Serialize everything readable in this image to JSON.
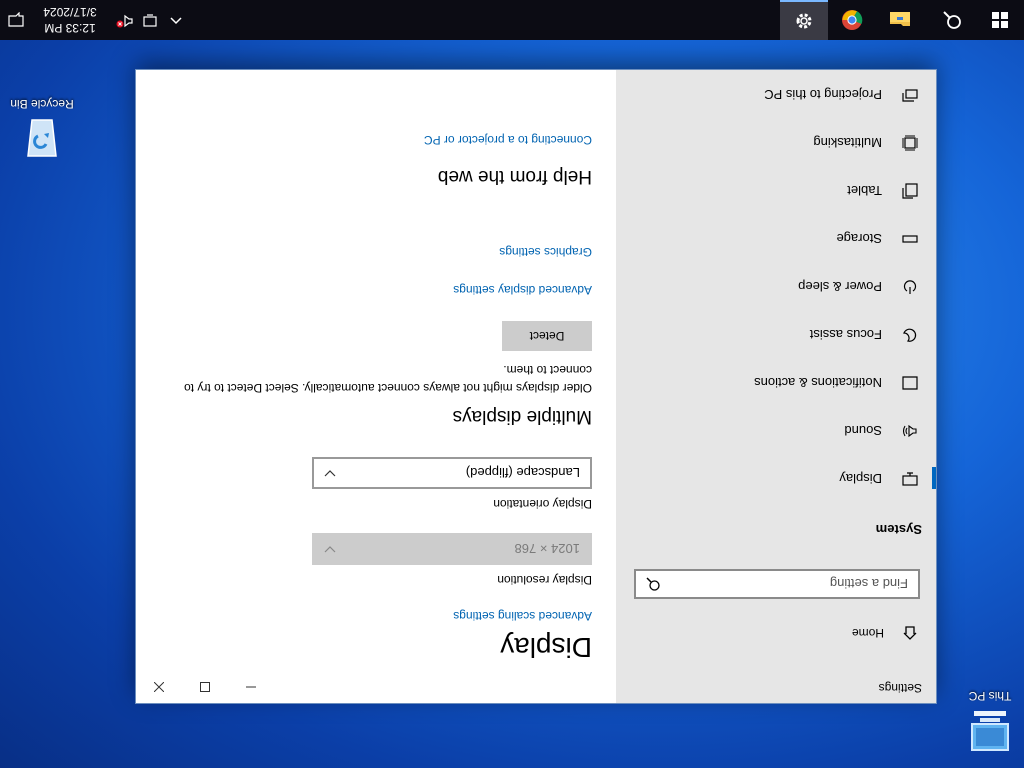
{
  "desktop": {
    "icons": [
      {
        "label": "This PC",
        "icon": "computer-icon"
      },
      {
        "label": "Recycle Bin",
        "icon": "recycle-bin-icon"
      }
    ]
  },
  "taskbar": {
    "clock_time": "12:33 PM",
    "clock_date": "3/17/2024",
    "apps": [
      "start",
      "search",
      "file-explorer",
      "chrome",
      "settings"
    ]
  },
  "window": {
    "app_title": "Settings",
    "home_label": "Home",
    "search_placeholder": "Find a setting",
    "section_label": "System",
    "nav": [
      {
        "label": "Display",
        "icon": "monitor-icon",
        "active": true
      },
      {
        "label": "Sound",
        "icon": "speaker-icon",
        "active": false
      },
      {
        "label": "Notifications & actions",
        "icon": "notification-icon",
        "active": false
      },
      {
        "label": "Focus assist",
        "icon": "moon-icon",
        "active": false
      },
      {
        "label": "Power & sleep",
        "icon": "power-icon",
        "active": false
      },
      {
        "label": "Storage",
        "icon": "storage-icon",
        "active": false
      },
      {
        "label": "Tablet",
        "icon": "tablet-icon",
        "active": false
      },
      {
        "label": "Multitasking",
        "icon": "multitasking-icon",
        "active": false
      },
      {
        "label": "Projecting to this PC",
        "icon": "projecting-icon",
        "active": false
      }
    ]
  },
  "display": {
    "title": "Display",
    "advanced_scaling_link": "Advanced scaling settings",
    "resolution_label": "Display resolution",
    "resolution_value": "1024 × 768",
    "orientation_label": "Display orientation",
    "orientation_value": "Landscape (flipped)",
    "multiple_title": "Multiple displays",
    "multiple_desc": "Older displays might not always connect automatically. Select Detect to try to connect to them.",
    "detect_button": "Detect",
    "advanced_display_link": "Advanced display settings",
    "graphics_link": "Graphics settings",
    "help_title": "Help from the web",
    "help_link": "Connecting to a projector or PC"
  }
}
